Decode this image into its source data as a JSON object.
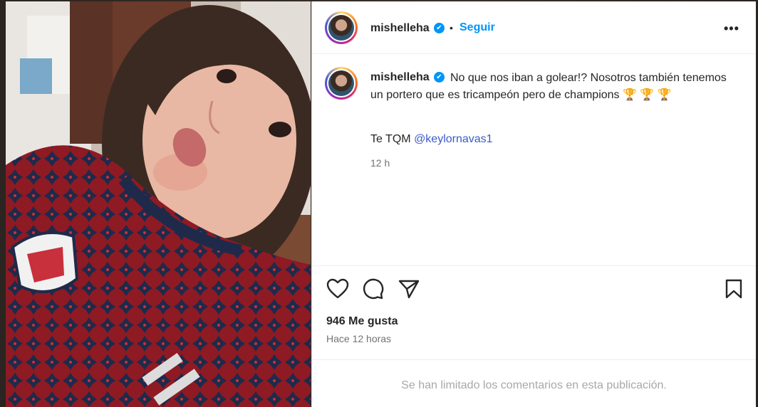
{
  "post": {
    "username": "mishelleha",
    "verified_mark": "✔",
    "separator": "•",
    "follow_label": "Seguir",
    "more_label": "•••",
    "caption_text": "No que nos iban a golear!? Nosotros también tenemos un portero que es tricampeón pero de champions 🏆 🏆 🏆",
    "caption_line2_prefix": "Te TQM",
    "caption_mention": "@keylornavas1",
    "caption_time": "12 h",
    "likes": "946 Me gusta",
    "posted_ago": "Hace 12 horas",
    "comments_limited": "Se han limitado los comentarios en esta publicación."
  },
  "icons": {
    "like": "heart-icon",
    "comment": "comment-icon",
    "share": "send-icon",
    "save": "bookmark-icon",
    "more": "more-options-icon"
  },
  "colors": {
    "follow": "#0095f6",
    "verified": "#0095f6",
    "mention": "#3a5ac9",
    "muted": "#737373",
    "limited": "#a8a8a8"
  }
}
